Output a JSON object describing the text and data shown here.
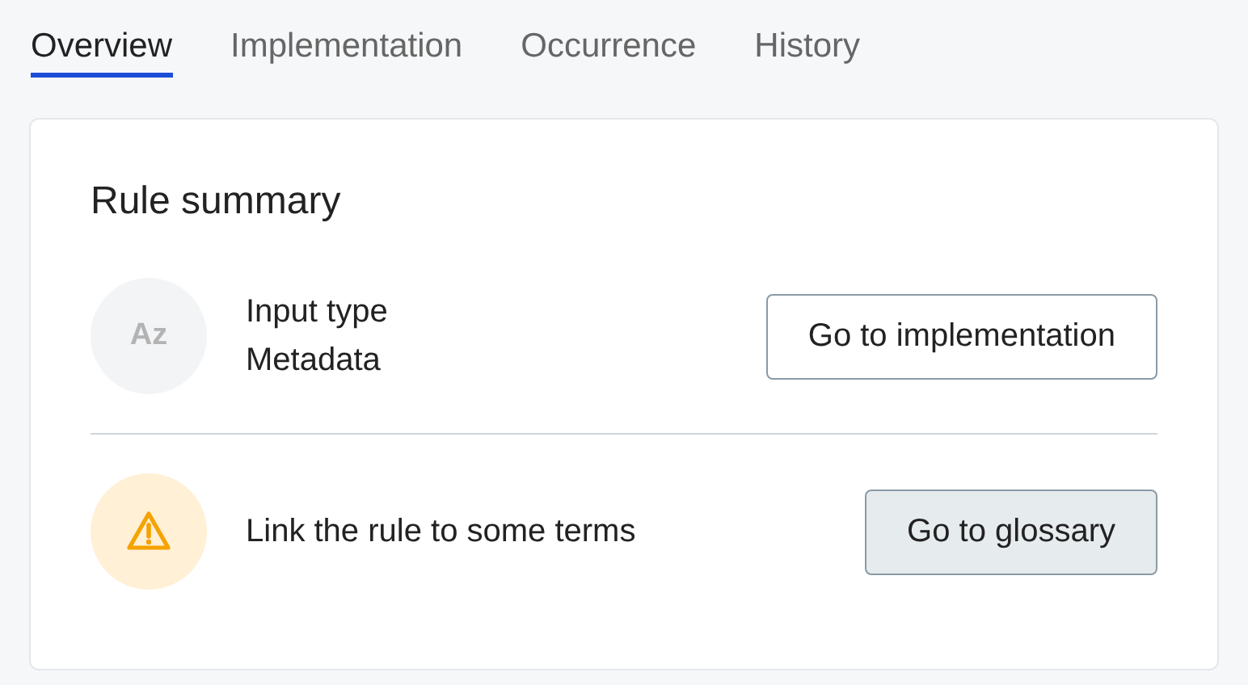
{
  "tabs": [
    {
      "label": "Overview",
      "selected": true
    },
    {
      "label": "Implementation",
      "selected": false
    },
    {
      "label": "Occurrence",
      "selected": false
    },
    {
      "label": "History",
      "selected": false
    }
  ],
  "card": {
    "title": "Rule summary",
    "rows": [
      {
        "kind": "info",
        "badge": "Az",
        "title": "Input type",
        "subtitle": "Metadata",
        "button": {
          "label": "Go to implementation"
        }
      },
      {
        "kind": "warning",
        "title": "Link the rule to some terms",
        "button": {
          "label": "Go to glossary"
        }
      }
    ]
  }
}
